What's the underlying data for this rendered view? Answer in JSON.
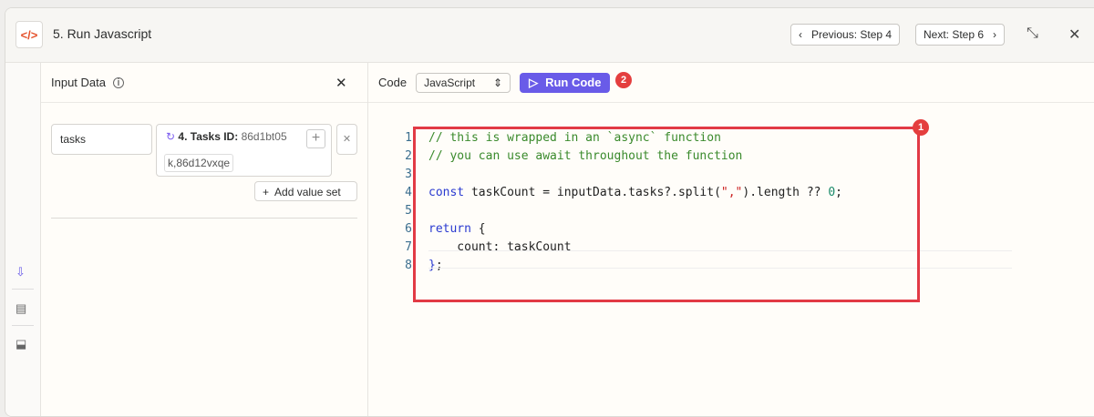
{
  "header": {
    "title": "5. Run Javascript",
    "logo_icon": "code-icon",
    "prev": "Previous: Step 4",
    "next": "Next: Step 6"
  },
  "input": {
    "title": "Input Data",
    "key": "tasks",
    "pill_label": "4. Tasks ID:",
    "pill_value": "86d1bt05",
    "pill_cont": "k,86d12vxqe",
    "add": "Add value set"
  },
  "code": {
    "label": "Code",
    "language": "JavaScript",
    "run": "Run Code",
    "badge1": "1",
    "badge2": "2",
    "lines": [
      {
        "n": "1",
        "t": "// this is wrapped in an `async` function"
      },
      {
        "n": "2",
        "t": "// you can use await throughout the function"
      },
      {
        "n": "3",
        "t": ""
      },
      {
        "n": "4",
        "a": "const",
        "b": " taskCount = inputData.tasks?.split(",
        "c": "\",\"",
        "d": ").length ?? ",
        "e": "0",
        "f": ";"
      },
      {
        "n": "5",
        "t": ""
      },
      {
        "n": "6",
        "a": "return",
        "b": " {"
      },
      {
        "n": "7",
        "t": "    count: taskCount"
      },
      {
        "n": "8",
        "a": "}",
        "b": ";"
      }
    ]
  }
}
